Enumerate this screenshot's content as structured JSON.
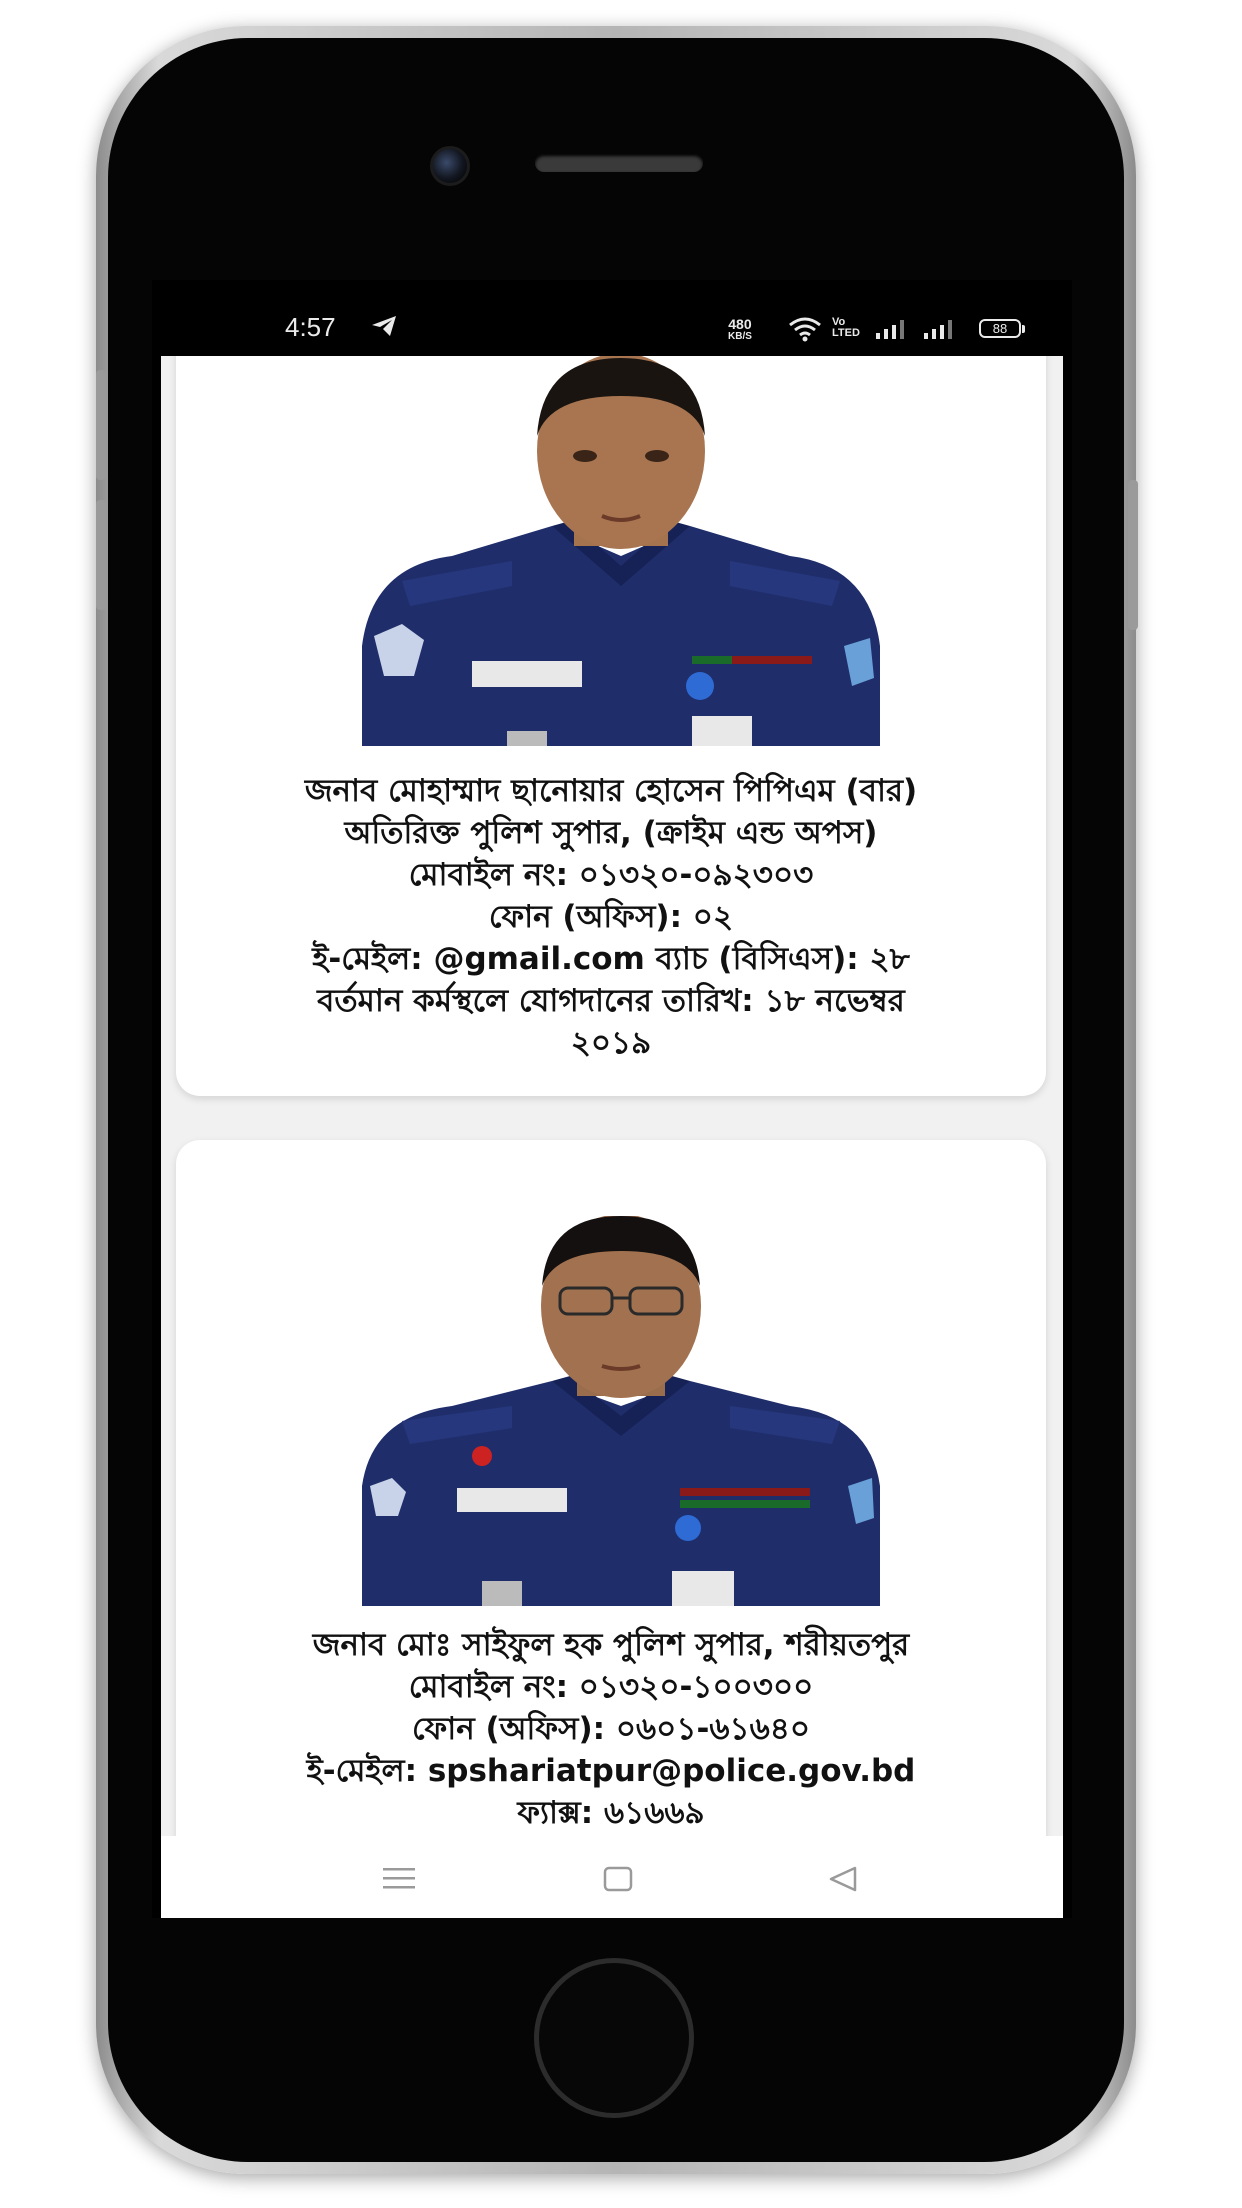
{
  "status_bar": {
    "time": "4:57",
    "net_speed_value": "480",
    "net_speed_unit": "KB/S",
    "volte_top": "Vo",
    "volte_bottom": "LTED",
    "battery": "88"
  },
  "officers": [
    {
      "name": "জনাব মোহাম্মাদ ছানোয়ার হোসেন পিপিএম (বার)",
      "designation": "অতিরিক্ত পুলিশ সুপার, (ক্রাইম এন্ড অপস)",
      "mobile": "মোবাইল নং: ০১৩২০-০৯২৩০৩",
      "phone": "ফোন (অফিস): ০২",
      "email_batch": "ই-মেইল: @gmail.com ব্যাচ (বিসিএস): ২৮",
      "joining_line1": "বর্তমান কর্মস্থলে যোগদানের তারিখ: ১৮ নভেম্বর",
      "joining_line2": "২০১৯"
    },
    {
      "name": "জনাব মোঃ সাইফুল হক পুলিশ সুপার, শরীয়তপুর",
      "mobile": "মোবাইল নং: ০১৩২০-১০০৩০০",
      "phone": "ফোন (অফিস): ০৬০১-৬১৬৪০",
      "email": "ই-মেইল: spshariatpur@police.gov.bd",
      "fax": "ফ্যাক্স: ৬১৬৬৯"
    }
  ],
  "icons": {
    "status": [
      "telegram-icon",
      "wifi-icon",
      "signal-icon",
      "battery-icon"
    ],
    "nav": [
      "menu-icon",
      "home-square-icon",
      "back-triangle-icon"
    ]
  },
  "colors": {
    "uniform": "#1f2e6b",
    "card_bg": "#ffffff",
    "page_bg": "#f1f1f1",
    "status_bar_bg": "#000000"
  }
}
